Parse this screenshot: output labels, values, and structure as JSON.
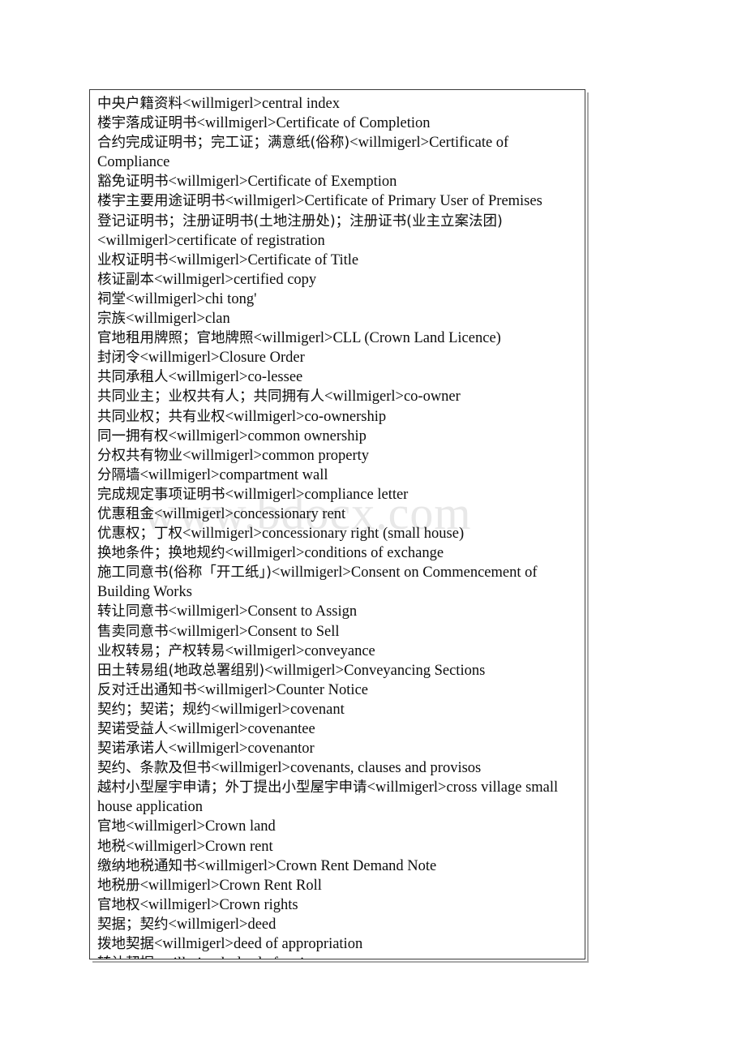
{
  "document": {
    "type": "glossary-table",
    "watermark": "www.bdocx.com",
    "separator": "<willmigerl>",
    "border_color": "#3a3a3a",
    "shadow_color": "#a9a9a9",
    "text_color": "#0d0d0d",
    "watermark_color": "#e8e8e8",
    "background_color": "#ffffff"
  },
  "glossary": {
    "entries": [
      {
        "chinese": "中央户籍资料",
        "english": "central index"
      },
      {
        "chinese": "楼宇落成证明书",
        "english": "Certificate of Completion"
      },
      {
        "chinese": "合约完成证明书；完工证；满意纸(俗称)",
        "english": "Certificate of Compliance"
      },
      {
        "chinese": "豁免证明书",
        "english": "Certificate of Exemption"
      },
      {
        "chinese": "楼宇主要用途证明书",
        "english": "Certificate of Primary User of Premises"
      },
      {
        "chinese": "登记证明书；注册证明书(土地注册处)；注册证书(业主立案法团)",
        "english": "certificate of registration"
      },
      {
        "chinese": "业权证明书",
        "english": "Certificate of Title"
      },
      {
        "chinese": "核证副本",
        "english": "certified copy"
      },
      {
        "chinese": "祠堂",
        "english": "chi tong'"
      },
      {
        "chinese": "宗族",
        "english": "clan"
      },
      {
        "chinese": "官地租用牌照；官地牌照",
        "english": "CLL (Crown Land Licence)"
      },
      {
        "chinese": "封闭令",
        "english": "Closure Order"
      },
      {
        "chinese": "共同承租人",
        "english": "co-lessee"
      },
      {
        "chinese": "共同业主；业权共有人；共同拥有人",
        "english": "co-owner"
      },
      {
        "chinese": "共同业权；共有业权",
        "english": "co-ownership"
      },
      {
        "chinese": "同一拥有权",
        "english": "common ownership"
      },
      {
        "chinese": "分权共有物业",
        "english": "common property"
      },
      {
        "chinese": "分隔墙",
        "english": "compartment wall"
      },
      {
        "chinese": "完成规定事项证明书",
        "english": "compliance letter"
      },
      {
        "chinese": "优惠租金",
        "english": "concessionary rent"
      },
      {
        "chinese": "优惠权；丁权",
        "english": "concessionary right (small house)"
      },
      {
        "chinese": "换地条件；换地规约",
        "english": "conditions of exchange"
      },
      {
        "chinese": "施工同意书(俗称「开工纸」)",
        "english": "Consent on Commencement of Building Works"
      },
      {
        "chinese": "转让同意书",
        "english": "Consent to Assign"
      },
      {
        "chinese": "售卖同意书",
        "english": "Consent to Sell"
      },
      {
        "chinese": "业权转易；产权转易",
        "english": "conveyance"
      },
      {
        "chinese": "田土转易组(地政总署组别)",
        "english": "Conveyancing Sections"
      },
      {
        "chinese": "反对迁出通知书",
        "english": "Counter Notice"
      },
      {
        "chinese": "契约；契诺；规约",
        "english": "covenant"
      },
      {
        "chinese": "契诺受益人",
        "english": "covenantee"
      },
      {
        "chinese": "契诺承诺人",
        "english": "covenantor"
      },
      {
        "chinese": "契约、条款及但书",
        "english": "covenants, clauses and provisos"
      },
      {
        "chinese": "越村小型屋宇申请；外丁提出小型屋宇申请",
        "english": "cross village small house application"
      },
      {
        "chinese": "官地",
        "english": "Crown land"
      },
      {
        "chinese": "地税",
        "english": "Crown rent"
      },
      {
        "chinese": "缴纳地税通知书",
        "english": "Crown Rent Demand Note"
      },
      {
        "chinese": "地税册",
        "english": "Crown Rent Roll"
      },
      {
        "chinese": "官地权",
        "english": "Crown rights"
      },
      {
        "chinese": "契据；契约",
        "english": "deed"
      },
      {
        "chinese": "拨地契据",
        "english": "deed of appropriation"
      },
      {
        "chinese": "转让契据",
        "english": "deed of assignment"
      }
    ]
  }
}
